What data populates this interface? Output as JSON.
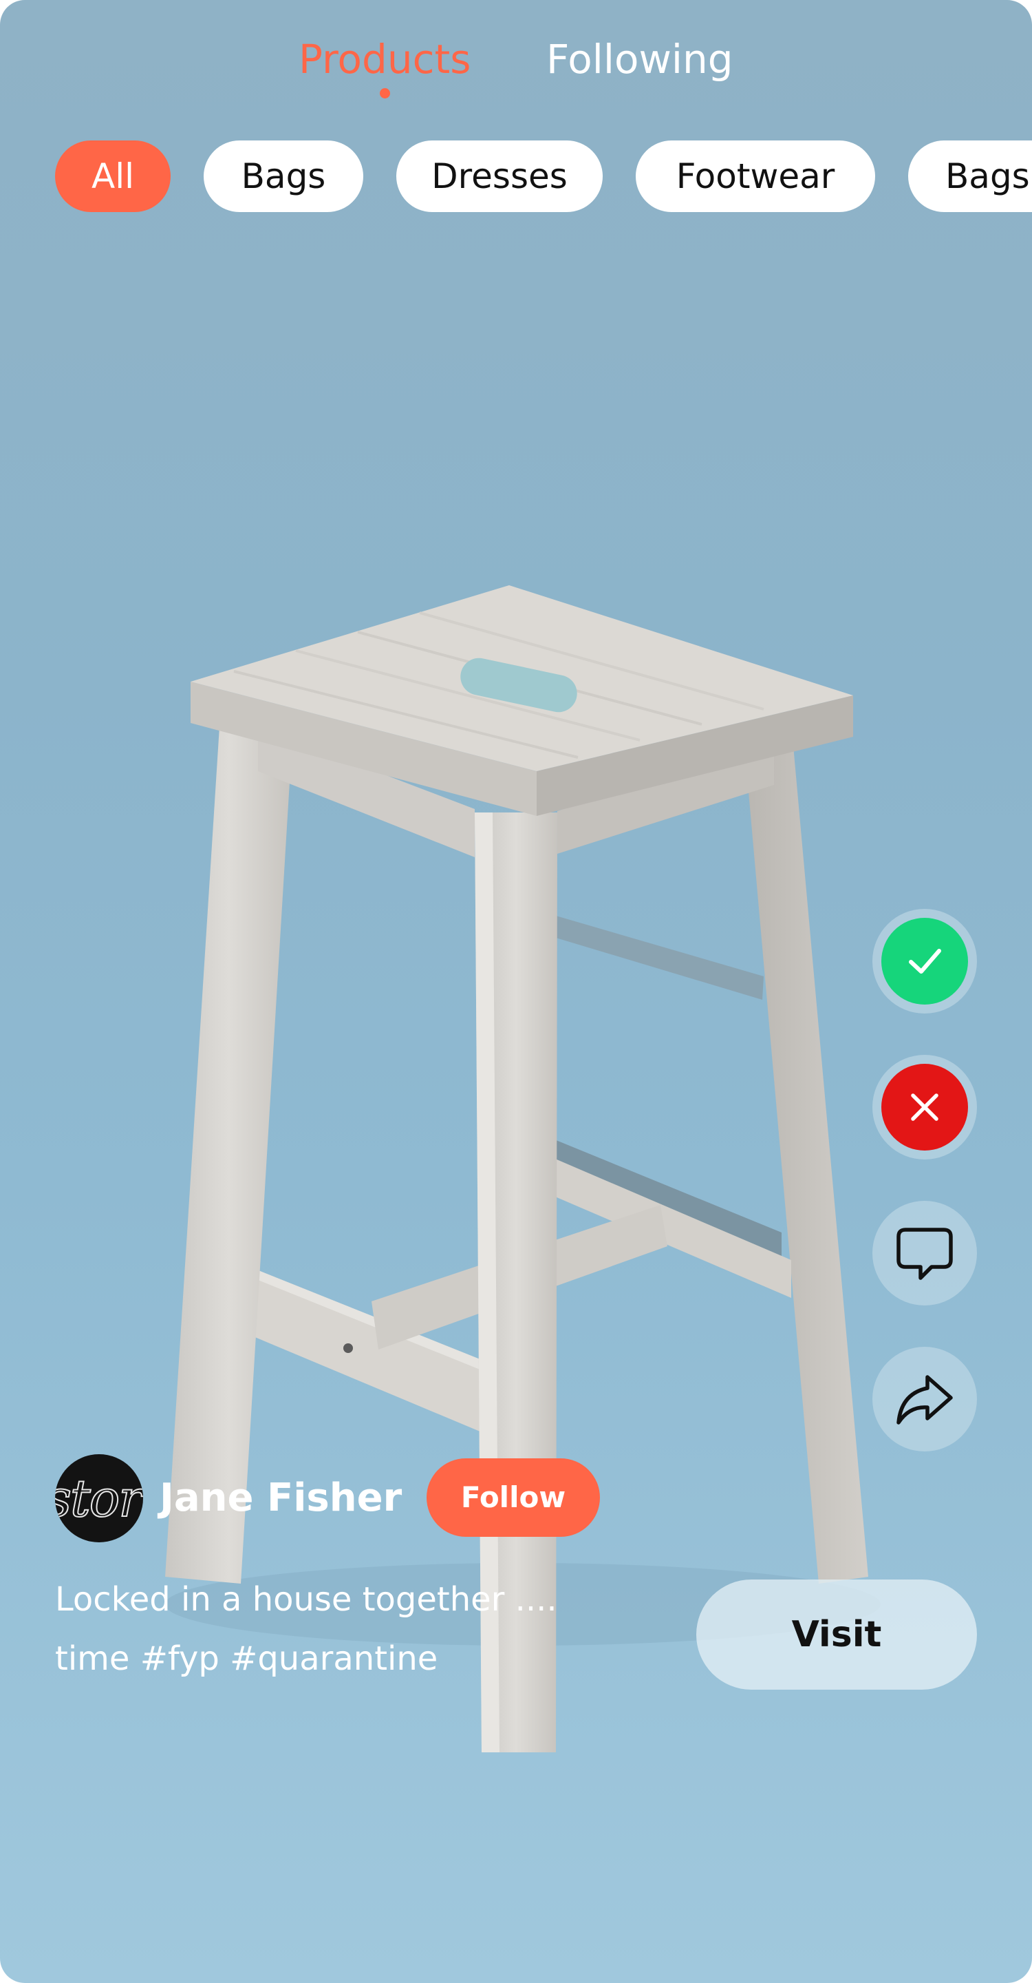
{
  "header": {
    "tabs": [
      {
        "label": "Products",
        "active": true
      },
      {
        "label": "Following",
        "active": false
      }
    ]
  },
  "categories": [
    {
      "label": "All",
      "active": true
    },
    {
      "label": "Bags",
      "active": false
    },
    {
      "label": "Dresses",
      "active": false
    },
    {
      "label": "Footwear",
      "active": false
    },
    {
      "label": "Bags",
      "active": false
    }
  ],
  "actions": {
    "accept_icon": "check-icon",
    "reject_icon": "close-icon",
    "comment_icon": "comment-icon",
    "share_icon": "share-icon"
  },
  "post": {
    "creator": {
      "name": "Jane Fisher",
      "avatar_text": "store"
    },
    "follow_label": "Follow",
    "caption_lines": [
      "Locked in a house together ....",
      "time #fyp #quarantine"
    ],
    "visit_label": "Visit"
  },
  "colors": {
    "accent": "#ff6647",
    "accept": "#16d57b",
    "reject": "#e31616",
    "background": "#8cb4cb"
  }
}
